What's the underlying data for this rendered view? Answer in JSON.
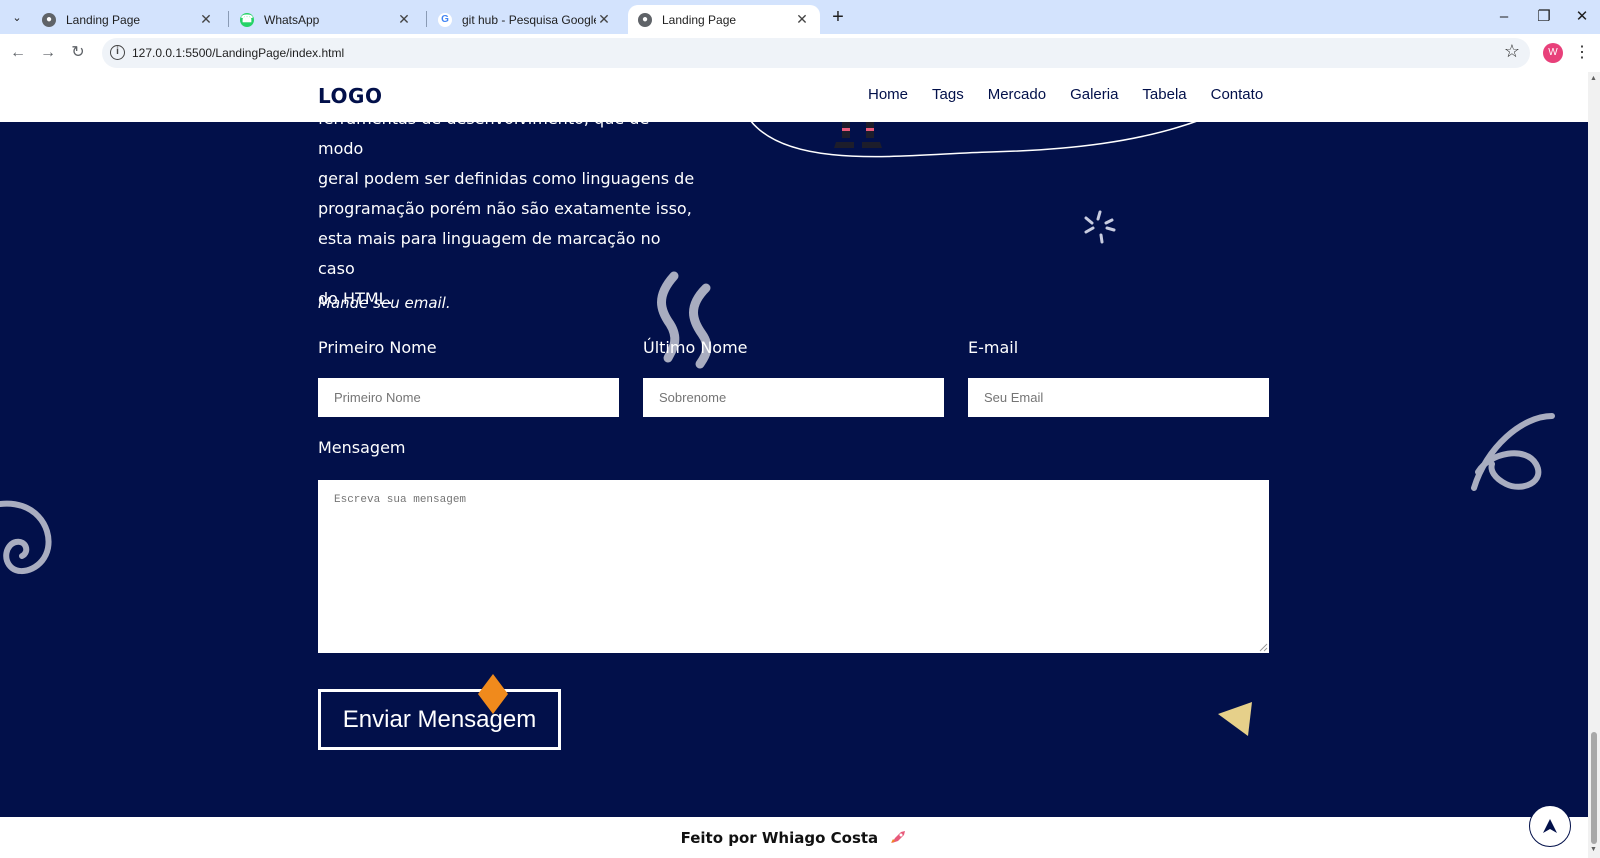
{
  "browser": {
    "tabs": [
      {
        "title": "Landing Page",
        "active": false,
        "icon": "globe-icon"
      },
      {
        "title": "WhatsApp",
        "active": false,
        "icon": "whatsapp-icon"
      },
      {
        "title": "git hub - Pesquisa Google",
        "active": false,
        "icon": "google-icon"
      },
      {
        "title": "Landing Page",
        "active": true,
        "icon": "globe-icon"
      }
    ],
    "url": "127.0.0.1:5500/LandingPage/index.html",
    "profile_initial": "W",
    "colors": {
      "tabbar": "#d3e3fd",
      "omnibox": "#eff3f8",
      "profile": "#e8407a"
    }
  },
  "header": {
    "logo": "LOGO",
    "nav": [
      "Home",
      "Tags",
      "Mercado",
      "Galeria",
      "Tabela",
      "Contato"
    ]
  },
  "intro": {
    "lines": [
      "ferramentas de desenvolvimento, que de modo",
      "geral podem ser definidas como linguagens de",
      "programação porém não são exatamente isso,",
      "esta mais para linguagem de marcação no caso",
      "do HTML."
    ]
  },
  "form": {
    "heading": "Mande seu email.",
    "first_name": {
      "label": "Primeiro Nome",
      "placeholder": "Primeiro Nome"
    },
    "last_name": {
      "label": "Último Nome",
      "placeholder": "Sobrenome"
    },
    "email": {
      "label": "E-mail",
      "placeholder": "Seu Email"
    },
    "message": {
      "label": "Mensagem",
      "placeholder": "Escreva sua mensagem"
    },
    "submit": "Enviar Mensagem"
  },
  "footer": {
    "text": "Feito por Whiago Costa",
    "icon": "rocket-icon"
  },
  "theme": {
    "background": "#02104a",
    "accent_orange": "#f08a1c",
    "accent_yellow": "#e6d08a",
    "deco_gray": "#a9adc0"
  }
}
